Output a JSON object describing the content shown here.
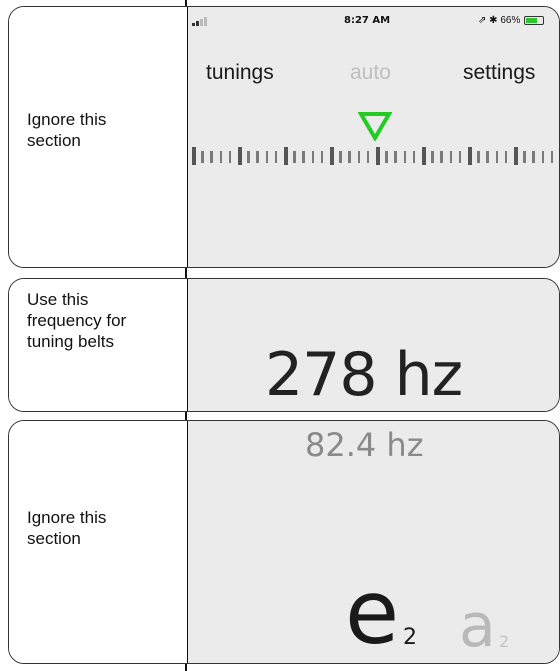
{
  "status_bar": {
    "time": "8:27 AM",
    "right_text": "⇗ ✱ 66%",
    "battery_level": 0.66
  },
  "nav": {
    "left": "tunings",
    "center": "auto",
    "right": "settings"
  },
  "annotations": {
    "top": "Ignore this\nsection",
    "middle": "Use this\nfrequency for\ntuning belts",
    "bottom": "Ignore this\nsection"
  },
  "frequency": {
    "current": "278 hz",
    "target": "82.4 hz"
  },
  "note": {
    "current_letter": "e",
    "current_octave": "2",
    "next_letter": "a",
    "next_octave": "2"
  },
  "colors": {
    "accent": "#22cc22",
    "screen_bg": "#ebebeb",
    "tick": "#666666",
    "battery": "#2cc52c"
  },
  "icons": {
    "pointer": "triangle-down-icon",
    "signal": "signal-bars-icon",
    "battery": "battery-icon"
  }
}
